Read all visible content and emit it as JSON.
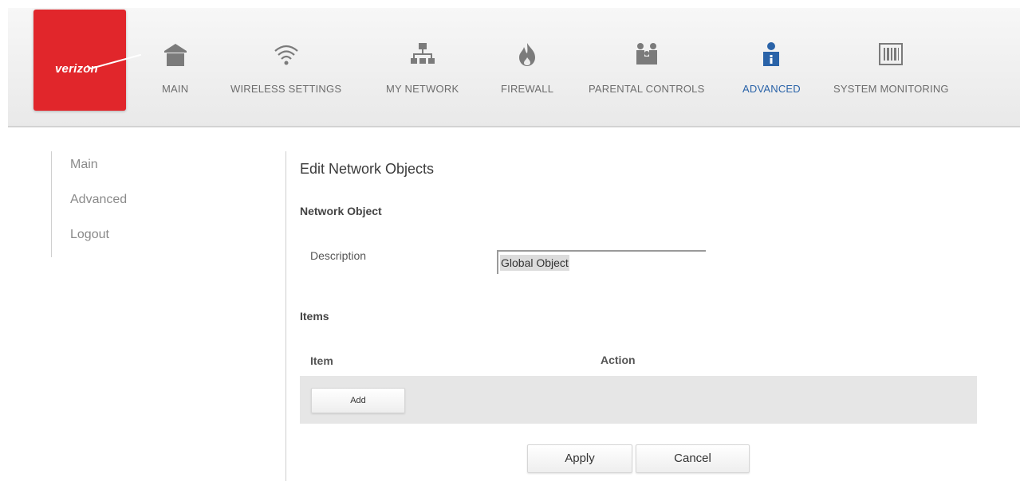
{
  "brand": {
    "logo_text": "verizon",
    "color": "#e1262b"
  },
  "nav": {
    "items": [
      {
        "label": "MAIN",
        "icon": "home-icon"
      },
      {
        "label": "WIRELESS SETTINGS",
        "icon": "wifi-icon"
      },
      {
        "label": "MY NETWORK",
        "icon": "network-icon"
      },
      {
        "label": "FIREWALL",
        "icon": "flame-icon"
      },
      {
        "label": "PARENTAL CONTROLS",
        "icon": "family-icon"
      },
      {
        "label": "ADVANCED",
        "icon": "user-info-icon",
        "active": true
      },
      {
        "label": "SYSTEM MONITORING",
        "icon": "monitor-icon"
      }
    ],
    "active_color": "#2a63a8"
  },
  "sidebar": {
    "items": [
      {
        "label": "Main"
      },
      {
        "label": "Advanced"
      },
      {
        "label": "Logout"
      }
    ]
  },
  "page": {
    "title": "Edit Network Objects",
    "network_object_heading": "Network Object",
    "description_label": "Description",
    "description_value": "Global Object",
    "items_heading": "Items",
    "table": {
      "columns": [
        "Item",
        "Action"
      ]
    },
    "add_label": "Add",
    "apply_label": "Apply",
    "cancel_label": "Cancel"
  }
}
